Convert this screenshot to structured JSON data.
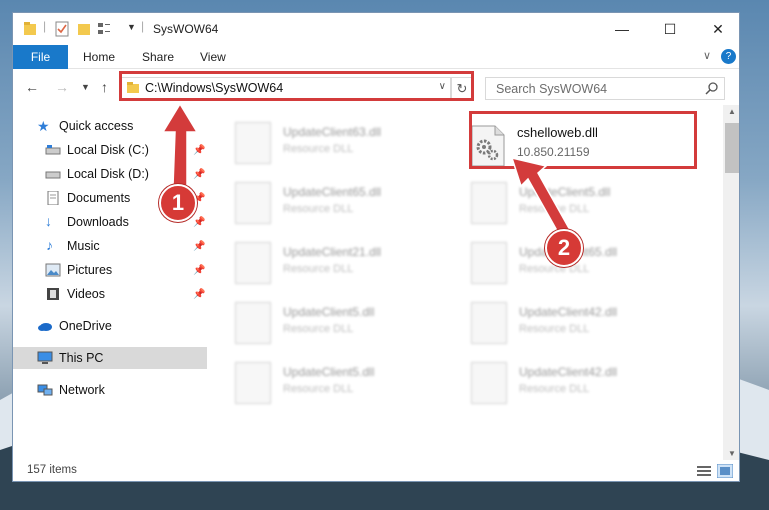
{
  "window": {
    "title": "SysWOW64",
    "controls": {
      "minimize": "—",
      "maximize": "☐",
      "close": "✕"
    }
  },
  "ribbon": {
    "file": "File",
    "tabs": [
      "Home",
      "Share",
      "View"
    ],
    "chevron": "∨",
    "help": "?"
  },
  "address": {
    "path": "C:\\Windows\\SysWOW64",
    "search_placeholder": "Search SysWOW64"
  },
  "sidebar": {
    "items": [
      {
        "label": "Quick access",
        "icon": "star-icon"
      },
      {
        "label": "Local Disk (C:)",
        "icon": "disk-icon"
      },
      {
        "label": "Local Disk (D:)",
        "icon": "disk-icon"
      },
      {
        "label": "Documents",
        "icon": "documents-icon"
      },
      {
        "label": "Downloads",
        "icon": "downloads-icon"
      },
      {
        "label": "Music",
        "icon": "music-icon"
      },
      {
        "label": "Pictures",
        "icon": "pictures-icon"
      },
      {
        "label": "Videos",
        "icon": "videos-icon"
      },
      {
        "label": "OneDrive",
        "icon": "cloud-icon"
      },
      {
        "label": "This PC",
        "icon": "computer-icon"
      },
      {
        "label": "Network",
        "icon": "network-icon"
      }
    ]
  },
  "files": {
    "highlighted": {
      "name": "cshelloweb.dll",
      "version": "10.850.21159"
    },
    "blurred": [
      {
        "name": "UpdateClient63.dll",
        "type": "Resource DLL"
      },
      {
        "name": "UpdateClient65.dll",
        "type": "Resource DLL"
      },
      {
        "name": "UpdateClient5.dll",
        "type": "Resource DLL"
      },
      {
        "name": "UpdateClient21.dll",
        "type": "Resource DLL"
      },
      {
        "name": "UpdateClient65.dll",
        "type": "Resource DLL"
      },
      {
        "name": "UpdateClient5.dll",
        "type": "Resource DLL"
      },
      {
        "name": "UpdateClient42.dll",
        "type": "Resource DLL"
      },
      {
        "name": "UpdateClient5.dll",
        "type": "Resource DLL"
      },
      {
        "name": "UpdateClient42.dll",
        "type": "Resource DLL"
      }
    ]
  },
  "status": {
    "items": "157 items"
  },
  "annotations": {
    "step1": "1",
    "step2": "2",
    "color": "#d33b3b"
  }
}
